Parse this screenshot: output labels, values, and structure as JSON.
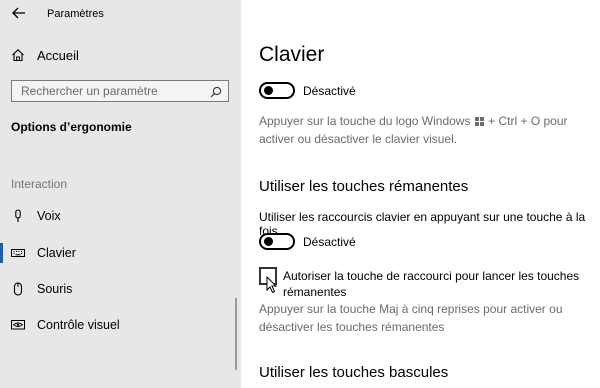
{
  "window": {
    "back_icon": "arrow-left-icon",
    "title": "Paramètres"
  },
  "sidebar": {
    "home": {
      "icon": "home-icon",
      "label": "Accueil"
    },
    "search": {
      "placeholder": "Rechercher un paramètre",
      "icon": "search-icon"
    },
    "section_title": "Options d’ergonomie",
    "group_label": "Interaction",
    "items": [
      {
        "icon": "microphone-icon",
        "label": "Voix",
        "active": false
      },
      {
        "icon": "keyboard-icon",
        "label": "Clavier",
        "active": true
      },
      {
        "icon": "mouse-icon",
        "label": "Souris",
        "active": false
      },
      {
        "icon": "eye-control-icon",
        "label": "Contrôle visuel",
        "active": false
      }
    ],
    "accent_color": "#1c5ea8"
  },
  "main": {
    "title": "Clavier",
    "onscreen_keyboard": {
      "toggle_state": "Désactivé",
      "description_before_logo": "Appuyer sur la touche du logo Windows",
      "description_after_logo": "+ Ctrl + O pour activer ou désactiver le clavier visuel."
    },
    "sticky_keys": {
      "heading": "Utiliser les touches rémanentes",
      "option_label": "Utiliser les raccourcis clavier en appuyant sur une touche à la fois",
      "toggle_state": "Désactivé",
      "checkbox_label": "Autoriser la touche de raccourci pour lancer les touches rémanentes",
      "checkbox_checked": false,
      "description": "Appuyer sur la touche Maj à cinq reprises pour activer ou désactiver les touches rémanentes"
    },
    "toggle_keys": {
      "heading": "Utiliser les touches bascules"
    }
  }
}
